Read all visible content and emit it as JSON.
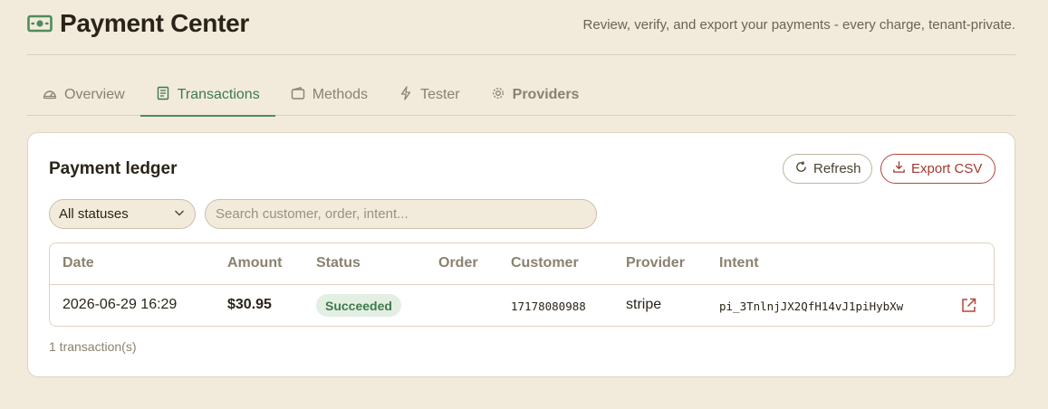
{
  "app": {
    "title": "Payment Center",
    "tagline": "Review, verify, and export your payments - every charge, tenant-private.",
    "brand_icon": "banknote-icon"
  },
  "tabs": [
    {
      "label": "Overview",
      "icon": "gauge-icon",
      "active": false
    },
    {
      "label": "Transactions",
      "icon": "receipt-icon",
      "active": true
    },
    {
      "label": "Methods",
      "icon": "wallet-icon",
      "active": false
    },
    {
      "label": "Tester",
      "icon": "lightning-icon",
      "active": false
    },
    {
      "label": "Providers",
      "icon": "gear-icon",
      "active": false
    }
  ],
  "ledger": {
    "title": "Payment ledger",
    "refresh_label": "Refresh",
    "export_label": "Export CSV",
    "status_filter": {
      "selected": "All statuses",
      "options": [
        "All statuses"
      ]
    },
    "search": {
      "value": "",
      "placeholder": "Search customer, order, intent..."
    },
    "columns": [
      "Date",
      "Amount",
      "Status",
      "Order",
      "Customer",
      "Provider",
      "Intent"
    ],
    "rows": [
      {
        "date": "2026-06-29 16:29",
        "amount": "$30.95",
        "status": "Succeeded",
        "order": "",
        "customer": "17178080988",
        "provider": "stripe",
        "intent": "pi_3TnlnjJX2QfH14vJ1piHybXw"
      }
    ],
    "count_text": "1 transaction(s)"
  },
  "colors": {
    "background": "#f2ebdc",
    "accent_green": "#3f7a4d",
    "export_red": "#a23a30",
    "badge_bg": "#e3efe2"
  }
}
